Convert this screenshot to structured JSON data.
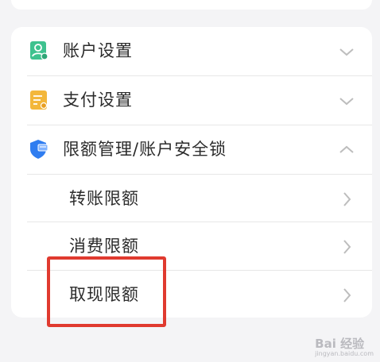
{
  "settings": {
    "items": [
      {
        "label": "账户设置",
        "icon": "account-user-icon",
        "chevron": "chevron-down-icon",
        "icon_color": "#3ec28f"
      },
      {
        "label": "支付设置",
        "icon": "payment-document-icon",
        "chevron": "chevron-down-icon",
        "icon_color": "#f3b73b"
      },
      {
        "label": "限额管理/账户安全锁",
        "icon": "shield-card-icon",
        "chevron": "chevron-up-icon",
        "icon_color": "#2f7df0"
      }
    ],
    "sub_items": [
      {
        "label": "转账限额",
        "chevron": "chevron-right-icon"
      },
      {
        "label": "消费限额",
        "chevron": "chevron-right-icon"
      },
      {
        "label": "取现限额",
        "chevron": "chevron-right-icon"
      }
    ]
  },
  "annotation": {
    "highlight_color": "#e03a2f"
  },
  "watermark": {
    "text": "Bai 经验",
    "sub": "jingyan.baidu.com"
  }
}
